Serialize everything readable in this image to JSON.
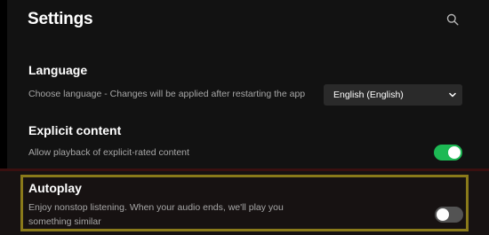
{
  "header": {
    "title": "Settings",
    "search_icon": "search-icon"
  },
  "language": {
    "title": "Language",
    "description": "Choose language - Changes will be applied after restarting the app",
    "selected": "English (English)"
  },
  "explicit": {
    "title": "Explicit content",
    "description": "Allow playback of explicit-rated content",
    "enabled": true
  },
  "autoplay": {
    "title": "Autoplay",
    "description_line1": "Enjoy nonstop listening. When your audio ends, we'll play you",
    "description_line2": "something similar",
    "enabled": false
  },
  "colors": {
    "background": "#121212",
    "accent": "#1db954",
    "highlight_border": "#8a7a1a"
  }
}
